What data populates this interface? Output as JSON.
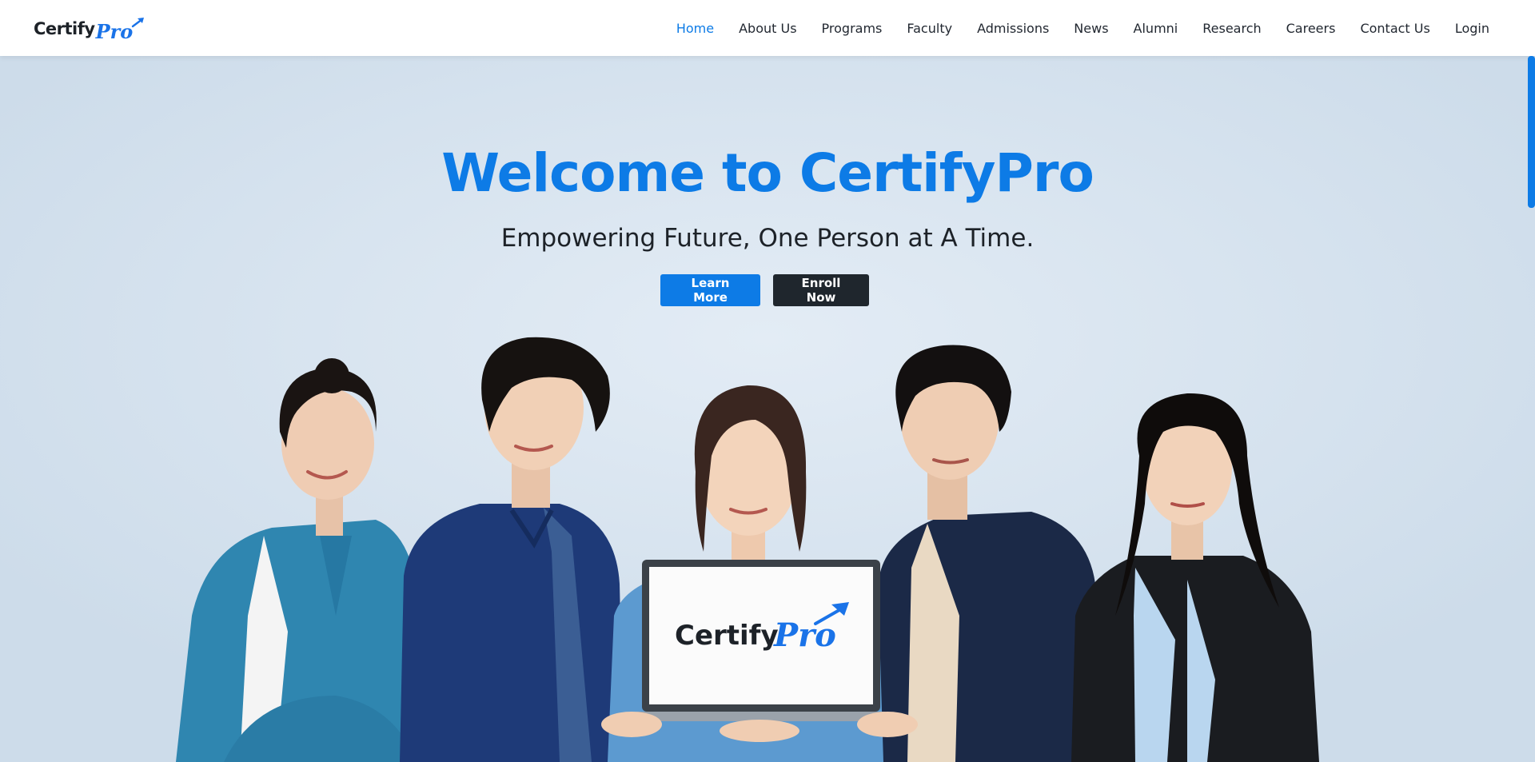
{
  "brand": {
    "logo_part1": "Certify",
    "logo_part2": "Pro",
    "primary_color": "#0d7be6",
    "dark_color": "#1f262d"
  },
  "nav": {
    "items": [
      {
        "label": "Home",
        "active": true
      },
      {
        "label": "About Us",
        "active": false
      },
      {
        "label": "Programs",
        "active": false
      },
      {
        "label": "Faculty",
        "active": false
      },
      {
        "label": "Admissions",
        "active": false
      },
      {
        "label": "News",
        "active": false
      },
      {
        "label": "Alumni",
        "active": false
      },
      {
        "label": "Research",
        "active": false
      },
      {
        "label": "Careers",
        "active": false
      },
      {
        "label": "Contact Us",
        "active": false
      },
      {
        "label": "Login",
        "active": false
      }
    ]
  },
  "hero": {
    "title": "Welcome to CertifyPro",
    "subtitle": "Empowering Future, One Person at A Time.",
    "primary_button": "Learn More",
    "secondary_button": "Enroll Now",
    "laptop_logo_part1": "Certify",
    "laptop_logo_part2": "Pro"
  }
}
